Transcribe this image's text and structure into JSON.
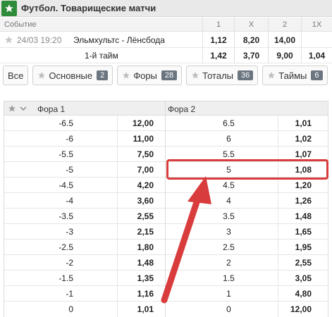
{
  "title": "Футбол. Товарищеские матчи",
  "market_header": {
    "event_label": "Событие",
    "cols": [
      "1",
      "X",
      "2",
      "1X"
    ]
  },
  "match": {
    "time": "24/03 19:20",
    "teams": "Эльмхультс - Лёнсбода",
    "odds": [
      "1,12",
      "8,20",
      "14,00",
      ""
    ]
  },
  "half": {
    "label": "1-й тайм",
    "odds": [
      "1,42",
      "3,70",
      "9,00",
      "1,04"
    ]
  },
  "tabs": [
    {
      "label": "Все",
      "badge": "",
      "star": false
    },
    {
      "label": "Основные",
      "badge": "2",
      "star": true
    },
    {
      "label": "Форы",
      "badge": "28",
      "star": true
    },
    {
      "label": "Тоталы",
      "badge": "36",
      "star": true
    },
    {
      "label": "Таймы",
      "badge": "6",
      "star": true
    }
  ],
  "handicap": {
    "col1": "Фора 1",
    "col2": "Фора 2",
    "rows": [
      {
        "f1": "-6.5",
        "o1": "12,00",
        "f2": "6.5",
        "o2": "1,01"
      },
      {
        "f1": "-6",
        "o1": "11,00",
        "f2": "6",
        "o2": "1,02"
      },
      {
        "f1": "-5.5",
        "o1": "7,50",
        "f2": "5.5",
        "o2": "1,07"
      },
      {
        "f1": "-5",
        "o1": "7,00",
        "f2": "5",
        "o2": "1,08"
      },
      {
        "f1": "-4.5",
        "o1": "4,20",
        "f2": "4.5",
        "o2": "1,20"
      },
      {
        "f1": "-4",
        "o1": "3,60",
        "f2": "4",
        "o2": "1,26"
      },
      {
        "f1": "-3.5",
        "o1": "2,55",
        "f2": "3.5",
        "o2": "1,48"
      },
      {
        "f1": "-3",
        "o1": "2,15",
        "f2": "3",
        "o2": "1,65"
      },
      {
        "f1": "-2.5",
        "o1": "1,80",
        "f2": "2.5",
        "o2": "1,95"
      },
      {
        "f1": "-2",
        "o1": "1,48",
        "f2": "2",
        "o2": "2,55"
      },
      {
        "f1": "-1.5",
        "o1": "1,35",
        "f2": "1.5",
        "o2": "3,05"
      },
      {
        "f1": "-1",
        "o1": "1,16",
        "f2": "1",
        "o2": "4,80"
      },
      {
        "f1": "0",
        "o1": "1,01",
        "f2": "0",
        "o2": "12,00"
      }
    ]
  },
  "colors": {
    "accent_green": "#2e8b3a",
    "highlight_red": "#d93c3c",
    "badge_gray": "#6b7580"
  }
}
